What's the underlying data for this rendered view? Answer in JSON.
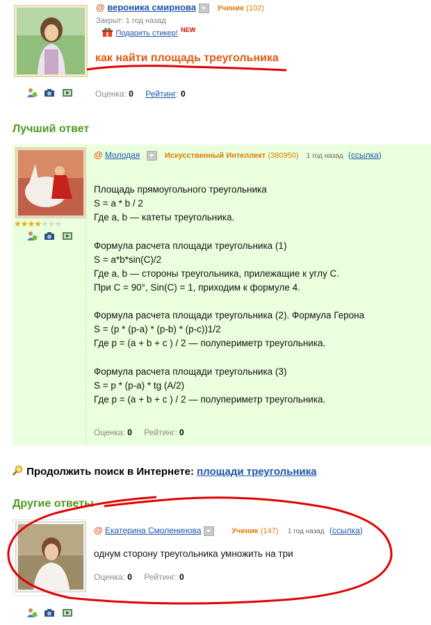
{
  "question": {
    "user_name": "вероника смирнова",
    "rank": "Ученик",
    "rank_points": "(102)",
    "status": "Закрыт: 1 год назад",
    "gift_link": "Подарить стикер!",
    "new_badge": "NEW",
    "title": "как найти площадь треугольника",
    "score_label": "Оценка:",
    "score_value": "0",
    "rating_label": "Рейтинг",
    "rating_colon": ":",
    "rating_value": "0"
  },
  "best_answer": {
    "section_title": "Лучший ответ",
    "user_name": "Молодая",
    "rank": "Искусственный Интеллект",
    "rank_points": "(380950)",
    "time": "1 год назад",
    "link_open": "(",
    "link_label": "ссылка",
    "link_close": ")",
    "stars_filled": 4,
    "stars_total": 7,
    "lines": [
      "Площадь прямоугольного треугольника",
      "S = a * b / 2",
      "Где a, b — катеты треугольника.",
      "Формула расчета площади треугольника (1)",
      "S = a*b*sin(C)/2",
      "Где a, b — стороны треугольника, прилежащие к углу C.",
      "При C = 90°, Sin(C) = 1, приходим к формуле 4.",
      "Формула расчета площади треугольника (2). Формула Герона",
      "S = (p * (p-a) * (p-b) * (p-c))1/2",
      "Где p = (a + b + c ) / 2 — полупериметр треугольника.",
      "Формула расчета площади треугольника (3)",
      "S = p * (p-a) * tg (A/2)",
      "Где p = (a + b + c ) / 2 — полупериметр треугольника."
    ],
    "score_label": "Оценка:",
    "score_value": "0",
    "rating_label": "Рейтинг:",
    "rating_value": "0"
  },
  "search": {
    "label": "Продолжить поиск в Интернете:",
    "link": "площади треугольника"
  },
  "other_answers": {
    "section_title": "Другие ответы",
    "items": [
      {
        "user_name": "Екатерина Смоленинова",
        "rank": "Ученик",
        "rank_points": "(147)",
        "time": "1 год назад",
        "link_open": "(",
        "link_label": "ссылка",
        "link_close": ")",
        "text": "однум сторону треугольника умножить на три",
        "score_label": "Оценка:",
        "score_value": "0",
        "rating_label": "Рейтинг:",
        "rating_value": "0"
      }
    ]
  },
  "icons": [
    "person-add-icon",
    "camera-icon",
    "video-icon",
    "gift-icon",
    "search-magnifier-icon",
    "at-icon",
    "dropdown-icon",
    "star-icon"
  ],
  "colors": {
    "link": "#1b54a8",
    "accent_orange": "#e55b1f",
    "rank_orange": "#e07b00",
    "section_green": "#4c9a1c",
    "answer_bg": "#eaffdd",
    "annotation_red": "#e00000"
  }
}
